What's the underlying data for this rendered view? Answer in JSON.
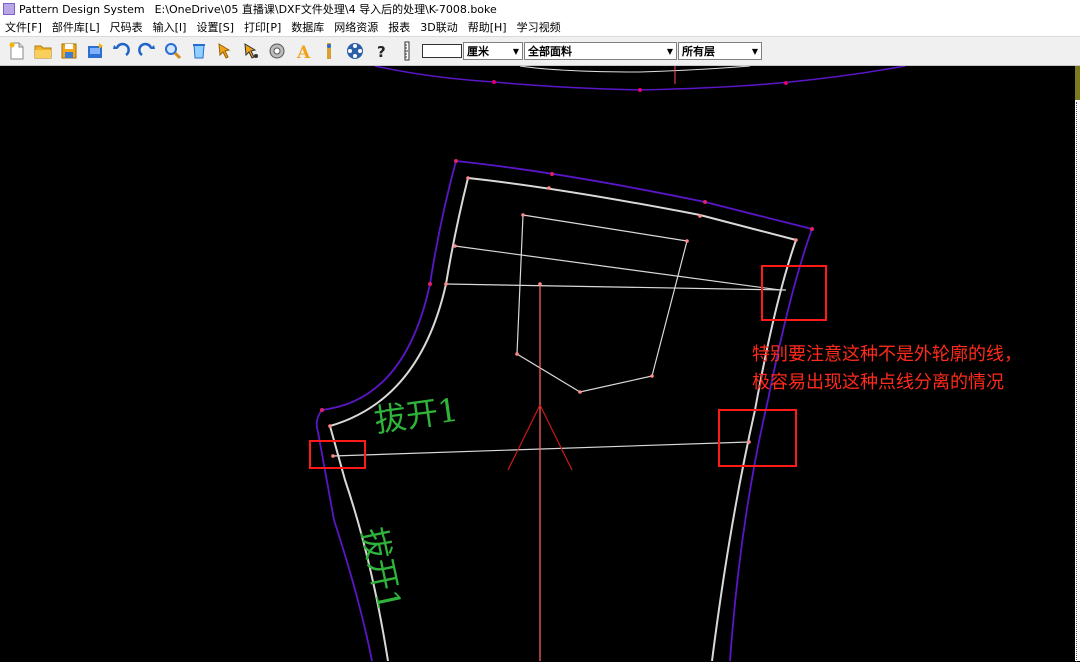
{
  "window": {
    "app_name": "Pattern Design System",
    "file_path": "E:\\OneDrive\\05  直播课\\DXF文件处理\\4 导入后的处理\\K-7008.boke"
  },
  "menu": [
    "文件[F]",
    "部件库[L]",
    "尺码表",
    "输入[I]",
    "设置[S]",
    "打印[P]",
    "数据库",
    "网络资源",
    "报表",
    "3D联动",
    "帮助[H]",
    "学习视频"
  ],
  "toolbar": {
    "icons": [
      "new-icon",
      "open-folder-icon",
      "save-icon",
      "import-icon",
      "undo-icon",
      "redo-icon",
      "zoom-icon",
      "clear-icon",
      "select-arrow-icon",
      "select-arrow-alt-icon",
      "measure-icon",
      "text-icon",
      "ruler-person-icon",
      "reel-icon",
      "help-icon",
      "vertical-ruler-icon"
    ],
    "unit_select": "厘米",
    "fabric_select": "全部面料",
    "layer_select": "所有层"
  },
  "canvas": {
    "piece_label_1": "拔开1",
    "piece_label_2": "拔开1",
    "annotation_lines": [
      "特别要注意这种不是外轮廓的线，",
      "极容易出现这种点线分离的情况"
    ]
  },
  "colors": {
    "background": "#000000",
    "outline": "#5a16c8",
    "seam": "#ffffff",
    "highlight": "#ff1a1a",
    "text_green": "#2fb33a"
  }
}
